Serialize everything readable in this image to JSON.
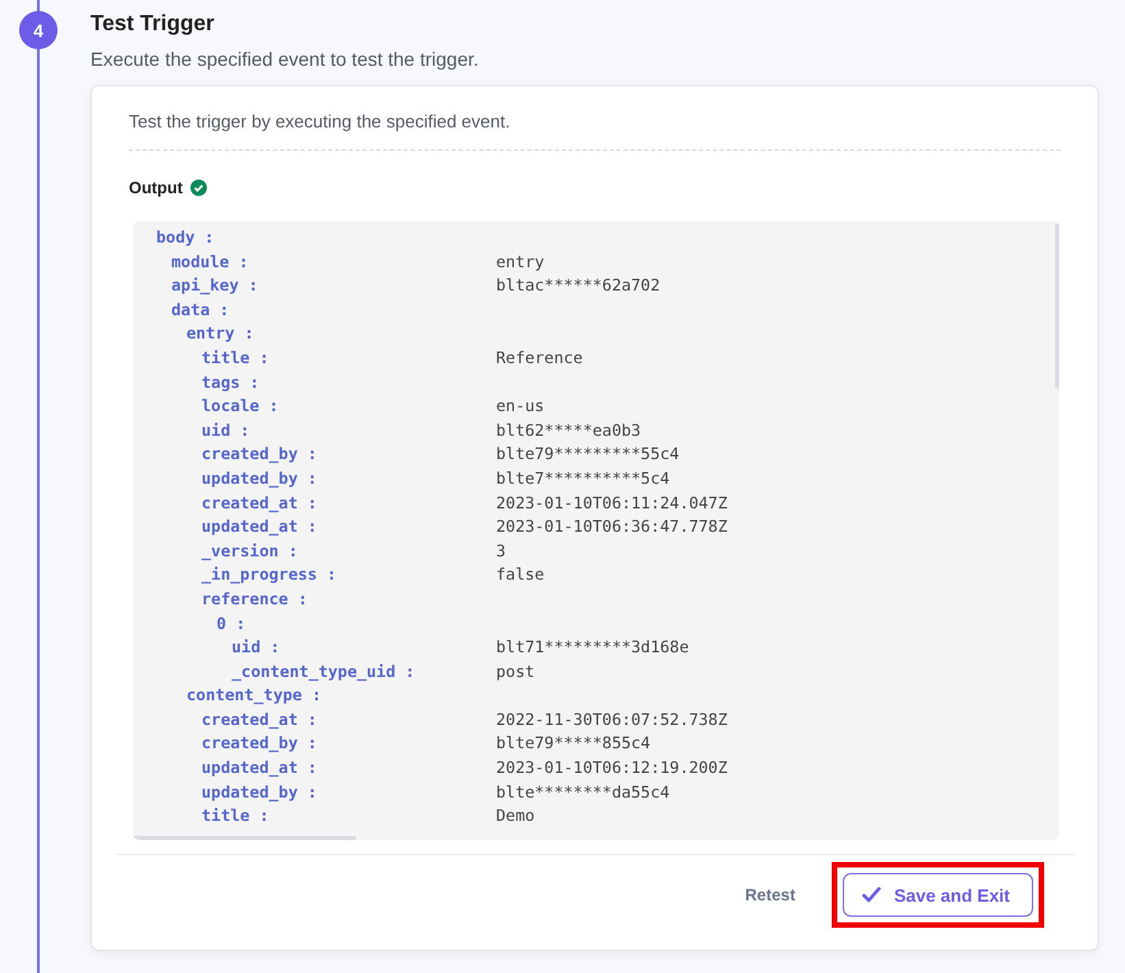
{
  "step": {
    "number": "4",
    "title": "Test Trigger",
    "description": "Execute the specified event to test the trigger."
  },
  "card": {
    "intro": "Test the trigger by executing the specified event.",
    "output_label": "Output",
    "output_ok": true
  },
  "output": [
    {
      "key": "body :",
      "children": [
        {
          "key": "module :",
          "value": "entry"
        },
        {
          "key": "api_key :",
          "value": "bltac******62a702"
        },
        {
          "key": "data :",
          "children": [
            {
              "key": "entry :",
              "children": [
                {
                  "key": "title :",
                  "value": "Reference"
                },
                {
                  "key": "tags :"
                },
                {
                  "key": "locale :",
                  "value": "en-us"
                },
                {
                  "key": "uid :",
                  "value": "blt62*****ea0b3"
                },
                {
                  "key": "created_by :",
                  "value": "blte79*********55c4"
                },
                {
                  "key": "updated_by :",
                  "value": "blte7**********5c4"
                },
                {
                  "key": "created_at :",
                  "value": "2023-01-10T06:11:24.047Z"
                },
                {
                  "key": "updated_at :",
                  "value": "2023-01-10T06:36:47.778Z"
                },
                {
                  "key": "_version :",
                  "value": "3"
                },
                {
                  "key": "_in_progress :",
                  "value": "false"
                },
                {
                  "key": "reference :",
                  "children": [
                    {
                      "key": "0 :",
                      "children": [
                        {
                          "key": "uid :",
                          "value": "blt71*********3d168e"
                        },
                        {
                          "key": "_content_type_uid :",
                          "value": "post"
                        }
                      ]
                    }
                  ]
                }
              ]
            },
            {
              "key": "content_type :",
              "children": [
                {
                  "key": "created_at :",
                  "value": "2022-11-30T06:07:52.738Z"
                },
                {
                  "key": "created_by :",
                  "value": "blte79*****855c4"
                },
                {
                  "key": "updated_at :",
                  "value": "2023-01-10T06:12:19.200Z"
                },
                {
                  "key": "updated_by :",
                  "value": "blte********da55c4"
                },
                {
                  "key": "title :",
                  "value": "Demo"
                }
              ]
            }
          ]
        }
      ]
    }
  ],
  "actions": [
    {
      "kind": "link",
      "label": "Retest",
      "highlighted": false
    },
    {
      "kind": "primary",
      "label": "Save and Exit",
      "highlighted": true
    }
  ]
}
